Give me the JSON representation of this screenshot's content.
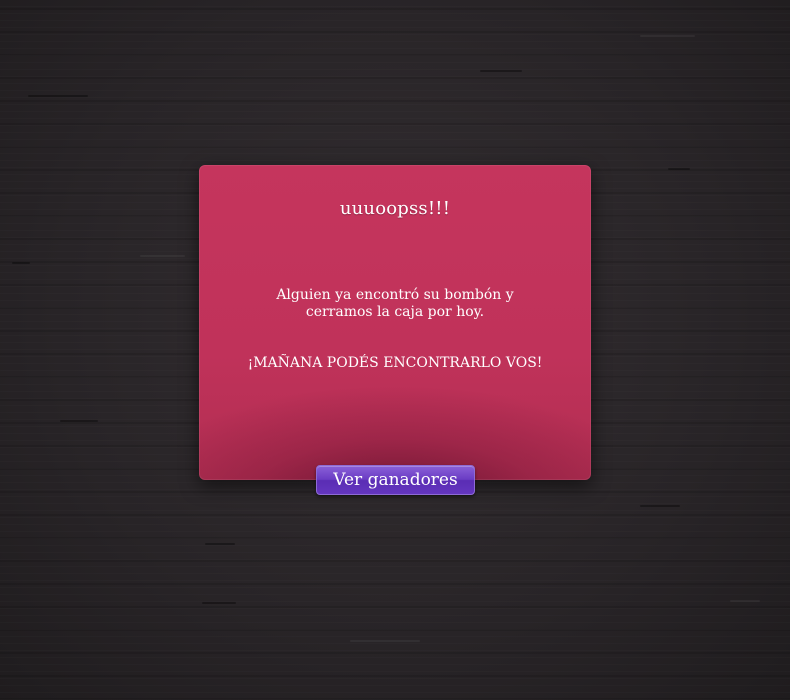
{
  "popup": {
    "title": "uuuoopss!!!",
    "message": "Alguien ya encontró su bombón y cerramos la caja por hoy.",
    "cta_text": "¡MAÑANA PODÉS ENCONTRARLO VOS!",
    "background_color": "#c0325a"
  },
  "actions": {
    "winners_button_label": "Ver ganadores",
    "button_color": "#6a3cc4"
  },
  "page": {
    "background_color": "#2a2628"
  }
}
